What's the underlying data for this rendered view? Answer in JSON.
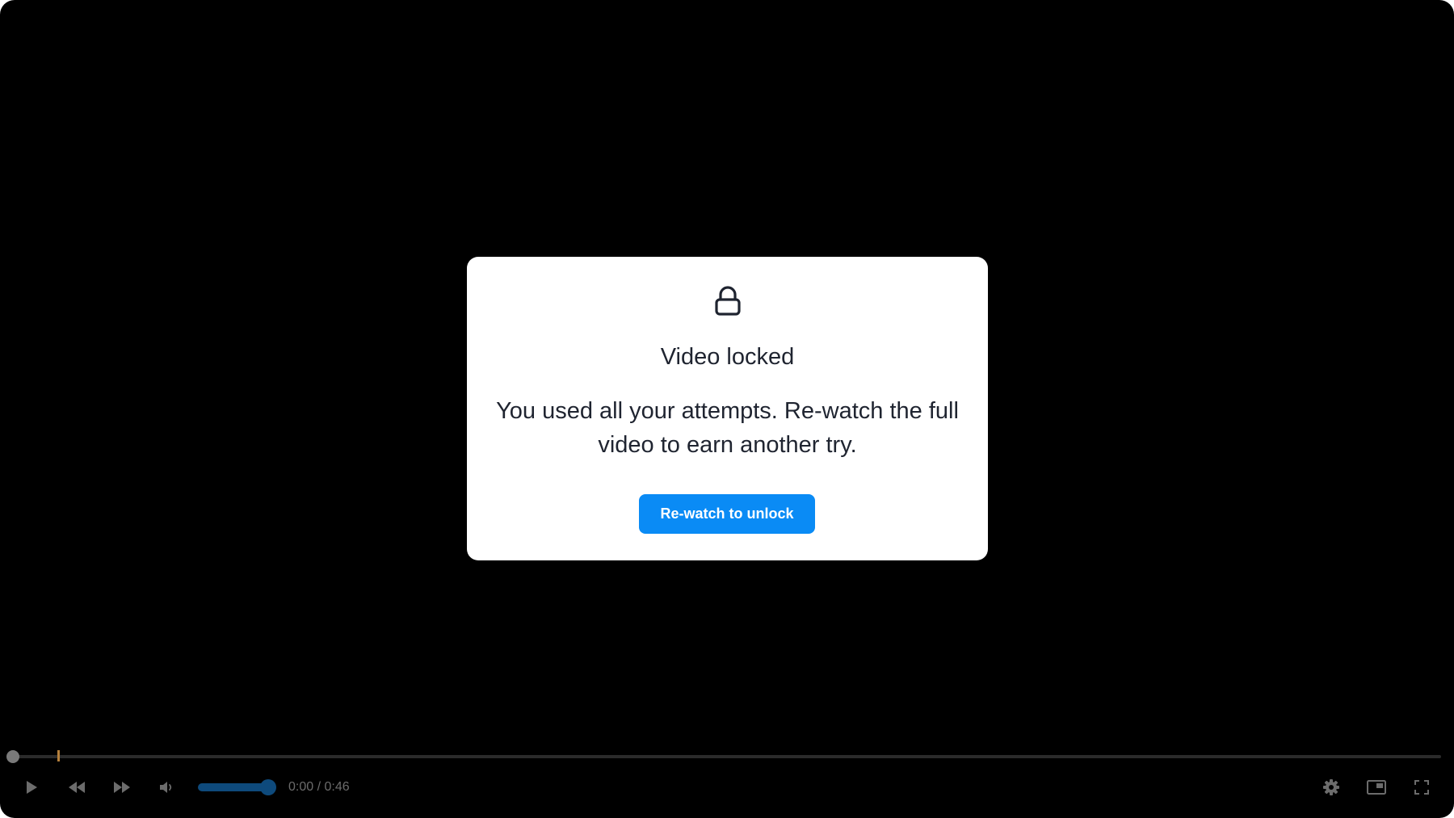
{
  "modal": {
    "icon": "lock-icon",
    "title": "Video locked",
    "message": "You used all your attempts. Re-watch the full video to earn another try.",
    "button_label": "Re-watch to unlock",
    "button_color": "#0a8bf5"
  },
  "player": {
    "background_color": "#000000",
    "playback": {
      "current_time": "0:00",
      "separator": " / ",
      "duration": "0:46",
      "progress_fraction": 0.0
    },
    "volume": {
      "level_fraction": 1.0,
      "color": "#0e4a7c"
    },
    "controls": {
      "left": [
        "play-icon",
        "rewind-icon",
        "fast-forward-icon",
        "volume-icon"
      ],
      "right": [
        "gear-icon",
        "picture-in-picture-icon",
        "fullscreen-icon"
      ]
    }
  }
}
